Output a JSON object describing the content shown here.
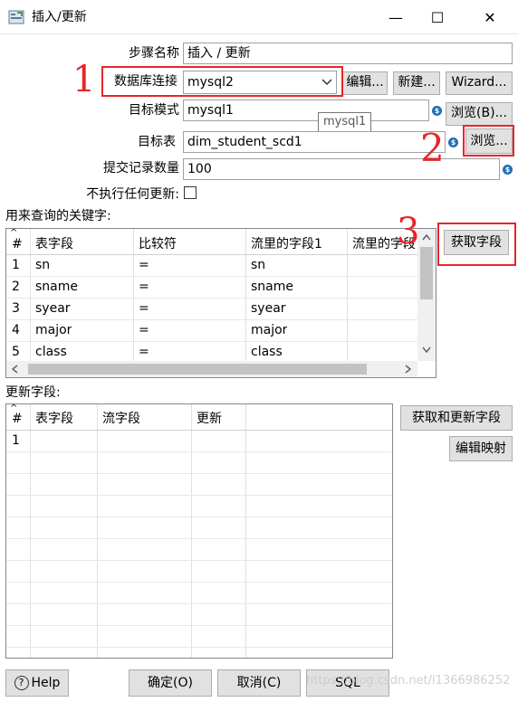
{
  "window": {
    "title": "插入/更新",
    "minimize": "—",
    "maximize": "☐",
    "close": "✕"
  },
  "form": {
    "step_name_label": "步骤名称",
    "step_name_value": "插入 / 更新",
    "db_conn_label": "数据库连接",
    "db_conn_value": "mysql2",
    "edit_btn": "编辑...",
    "new_btn": "新建...",
    "wizard_btn": "Wizard...",
    "schema_label": "目标模式",
    "schema_value": "mysql1",
    "browse_schema_btn": "浏览(B)...",
    "tooltip": "mysql1",
    "table_label": "目标表",
    "table_value": "dim_student_scd1",
    "browse_table_btn": "浏览...",
    "commit_label": "提交记录数量",
    "commit_value": "100",
    "no_update_label": "不执行任何更新:"
  },
  "keys": {
    "section_label": "用来查询的关键字:",
    "get_fields_btn": "获取字段",
    "columns": [
      "#",
      "表字段",
      "比较符",
      "流里的字段1",
      "流里的字段"
    ],
    "rows": [
      [
        "1",
        "sn",
        "=",
        "sn",
        ""
      ],
      [
        "2",
        "sname",
        "=",
        "sname",
        ""
      ],
      [
        "3",
        "syear",
        "=",
        "syear",
        ""
      ],
      [
        "4",
        "major",
        "=",
        "major",
        ""
      ],
      [
        "5",
        "class",
        "=",
        "class",
        ""
      ]
    ]
  },
  "updates": {
    "section_label": "更新字段:",
    "get_update_btn": "获取和更新字段",
    "edit_mapping_btn": "编辑映射",
    "columns": [
      "#",
      "表字段",
      "流字段",
      "更新"
    ],
    "rows": [
      [
        "1",
        "",
        "",
        ""
      ]
    ]
  },
  "footer": {
    "help_btn": "Help",
    "ok_btn": "确定(O)",
    "cancel_btn": "取消(C)",
    "sql_btn": "SQL",
    "watermark": "https://blog.csdn.net/l1366986252"
  },
  "annotations": {
    "one": "1",
    "two": "2",
    "three": "3"
  },
  "colors": {
    "annotation_red": "#e8242b",
    "var_icon_blue": "#1f6fb5"
  }
}
